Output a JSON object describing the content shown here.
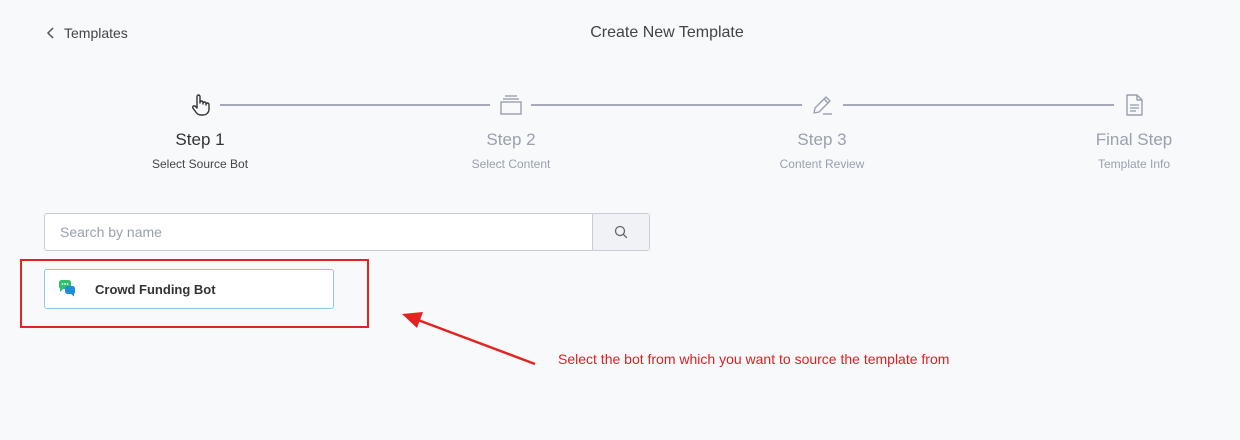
{
  "header": {
    "back_label": "Templates",
    "title": "Create New Template"
  },
  "stepper": {
    "steps": [
      {
        "title": "Step 1",
        "subtitle": "Select Source Bot",
        "icon": "hand-pointer-icon",
        "active": true
      },
      {
        "title": "Step 2",
        "subtitle": "Select Content",
        "icon": "stack-icon",
        "active": false
      },
      {
        "title": "Step 3",
        "subtitle": "Content Review",
        "icon": "pencil-icon",
        "active": false
      },
      {
        "title": "Final Step",
        "subtitle": "Template Info",
        "icon": "document-icon",
        "active": false
      }
    ]
  },
  "search": {
    "placeholder": "Search by name",
    "value": ""
  },
  "bots": [
    {
      "name": "Crowd Funding Bot",
      "icon": "chat-bubbles-icon"
    }
  ],
  "annotation": {
    "text": "Select the bot from which you want to source the template from",
    "color": "#e01e1e"
  },
  "colors": {
    "accent_border": "#8fc5e6",
    "annotation_red": "#e32222",
    "background": "#f8f9fb"
  }
}
